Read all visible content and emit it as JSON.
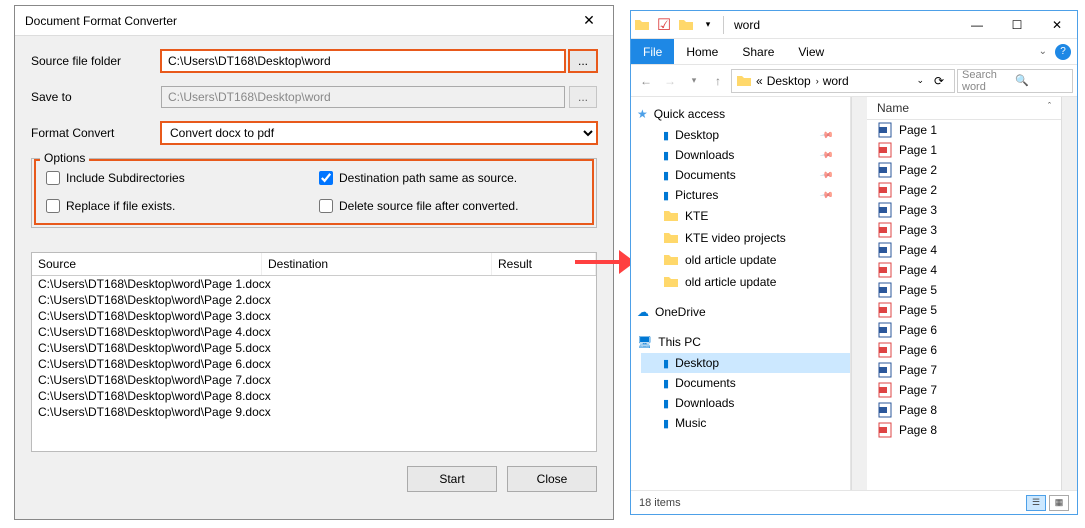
{
  "dialog": {
    "title": "Document Format Converter",
    "labels": {
      "source": "Source file folder",
      "saveto": "Save to",
      "format": "Format Convert",
      "options": "Options"
    },
    "source_path": "C:\\Users\\DT168\\Desktop\\word",
    "saveto_path": "C:\\Users\\DT168\\Desktop\\word",
    "browse": "...",
    "format_value": "Convert docx to pdf",
    "opts": {
      "inc_sub": "Include Subdirectories",
      "dest_same": "Destination path same as source.",
      "replace": "Replace if file exists.",
      "delete": "Delete source file after converted."
    },
    "checked": {
      "inc_sub": false,
      "dest_same": true,
      "replace": false,
      "delete": false
    },
    "cols": {
      "source": "Source",
      "dest": "Destination",
      "result": "Result"
    },
    "files": [
      "C:\\Users\\DT168\\Desktop\\word\\Page 1.docx",
      "C:\\Users\\DT168\\Desktop\\word\\Page 2.docx",
      "C:\\Users\\DT168\\Desktop\\word\\Page 3.docx",
      "C:\\Users\\DT168\\Desktop\\word\\Page 4.docx",
      "C:\\Users\\DT168\\Desktop\\word\\Page 5.docx",
      "C:\\Users\\DT168\\Desktop\\word\\Page 6.docx",
      "C:\\Users\\DT168\\Desktop\\word\\Page 7.docx",
      "C:\\Users\\DT168\\Desktop\\word\\Page 8.docx",
      "C:\\Users\\DT168\\Desktop\\word\\Page 9.docx"
    ],
    "buttons": {
      "start": "Start",
      "close": "Close"
    }
  },
  "explorer": {
    "foldername": "word",
    "tabs": {
      "file": "File",
      "home": "Home",
      "share": "Share",
      "view": "View"
    },
    "crumbs": {
      "a": "Desktop",
      "b": "word",
      "prefix": "«"
    },
    "search_placeholder": "Search word",
    "tree": {
      "quick": "Quick access",
      "quick_items": [
        "Desktop",
        "Downloads",
        "Documents",
        "Pictures",
        "KTE",
        "KTE video projects",
        "old article update",
        "old article update"
      ],
      "onedrive": "OneDrive",
      "thispc": "This PC",
      "pc_items": [
        "Desktop",
        "Documents",
        "Downloads",
        "Music"
      ]
    },
    "filehdr": "Name",
    "files": [
      {
        "n": "Page 1",
        "t": "docx"
      },
      {
        "n": "Page 1",
        "t": "pdf"
      },
      {
        "n": "Page 2",
        "t": "docx"
      },
      {
        "n": "Page 2",
        "t": "pdf"
      },
      {
        "n": "Page 3",
        "t": "docx"
      },
      {
        "n": "Page 3",
        "t": "pdf"
      },
      {
        "n": "Page 4",
        "t": "docx"
      },
      {
        "n": "Page 4",
        "t": "pdf"
      },
      {
        "n": "Page 5",
        "t": "docx"
      },
      {
        "n": "Page 5",
        "t": "pdf"
      },
      {
        "n": "Page 6",
        "t": "docx"
      },
      {
        "n": "Page 6",
        "t": "pdf"
      },
      {
        "n": "Page 7",
        "t": "docx"
      },
      {
        "n": "Page 7",
        "t": "pdf"
      },
      {
        "n": "Page 8",
        "t": "docx"
      },
      {
        "n": "Page 8",
        "t": "pdf"
      }
    ],
    "status": "18 items"
  }
}
